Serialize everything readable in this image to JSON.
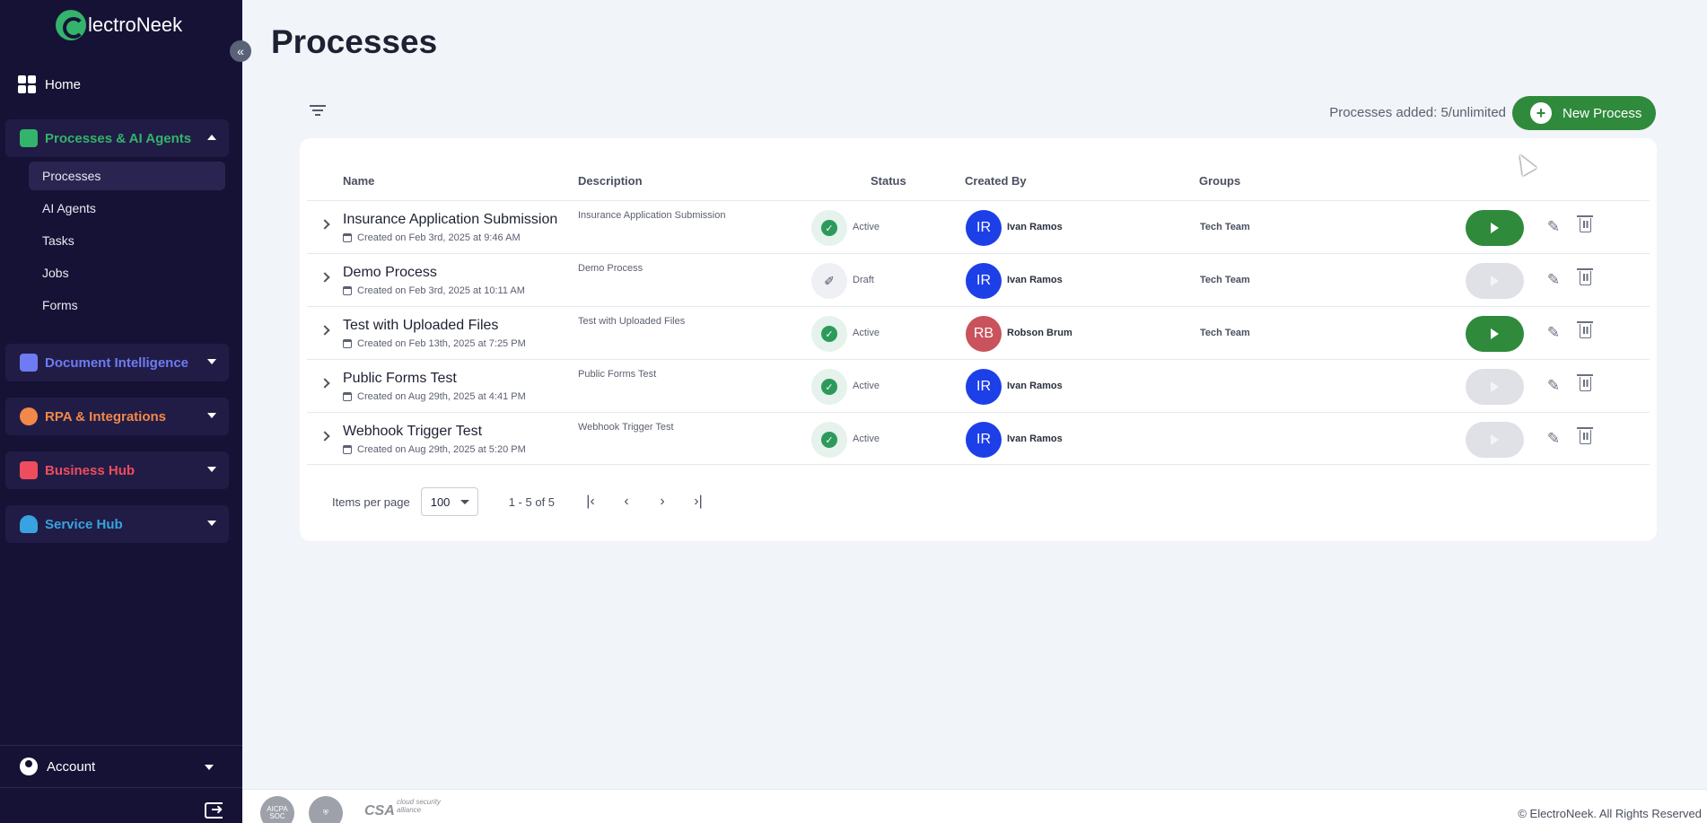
{
  "sidebar": {
    "logo_text": "lectroNeek",
    "collapse_icon": "«",
    "home_label": "Home",
    "groups": [
      {
        "label": "Processes & AI Agents",
        "color": "#33b36b"
      },
      {
        "label": "Document Intelligence",
        "color": "#6f7bf2"
      },
      {
        "label": "RPA & Integrations",
        "color": "#f2884a"
      },
      {
        "label": "Business Hub",
        "color": "#ef4d5e"
      },
      {
        "label": "Service Hub",
        "color": "#37a3e0"
      }
    ],
    "sub_items": [
      "Processes",
      "AI Agents",
      "Tasks",
      "Jobs",
      "Forms"
    ],
    "account_label": "Account"
  },
  "main": {
    "title": "Processes",
    "processes_added": "Processes added: 5/unlimited",
    "new_process_label": "New Process",
    "columns": [
      "Name",
      "Description",
      "Status",
      "Created By",
      "Groups"
    ],
    "rows": [
      {
        "name": "Insurance Application Submission",
        "created": "Created on Feb 3rd, 2025 at 9:46 AM",
        "description": "Insurance Application Submission",
        "status": "Active",
        "initials": "IR",
        "avatar_color": "#1d3fe8",
        "creator": "Ivan Ramos",
        "group": "Tech Team",
        "runnable": true
      },
      {
        "name": "Demo Process",
        "created": "Created on Feb 3rd, 2025 at 10:11 AM",
        "description": "Demo Process",
        "status": "Draft",
        "initials": "IR",
        "avatar_color": "#1d3fe8",
        "creator": "Ivan Ramos",
        "group": "Tech Team",
        "runnable": false
      },
      {
        "name": "Test with Uploaded Files",
        "created": "Created on Feb 13th, 2025 at 7:25 PM",
        "description": "Test with Uploaded Files",
        "status": "Active",
        "initials": "RB",
        "avatar_color": "#c9525c",
        "creator": "Robson Brum",
        "group": "Tech Team",
        "runnable": true
      },
      {
        "name": "Public Forms Test",
        "created": "Created on Aug 29th, 2025 at 4:41 PM",
        "description": "Public Forms Test",
        "status": "Active",
        "initials": "IR",
        "avatar_color": "#1d3fe8",
        "creator": "Ivan Ramos",
        "group": "",
        "runnable": false
      },
      {
        "name": "Webhook Trigger Test",
        "created": "Created on Aug 29th, 2025 at 5:20 PM",
        "description": "Webhook Trigger Test",
        "status": "Active",
        "initials": "IR",
        "avatar_color": "#1d3fe8",
        "creator": "Ivan Ramos",
        "group": "",
        "runnable": false
      }
    ],
    "pagination": {
      "items_per_page_label": "Items per page",
      "items_per_page_value": "100",
      "range": "1 - 5 of 5"
    }
  },
  "footer": {
    "badge1": "AICPA SOC",
    "csa": "CSA",
    "csa_sub": "cloud security alliance",
    "copyright": "© ElectroNeek. All Rights Reserved"
  }
}
